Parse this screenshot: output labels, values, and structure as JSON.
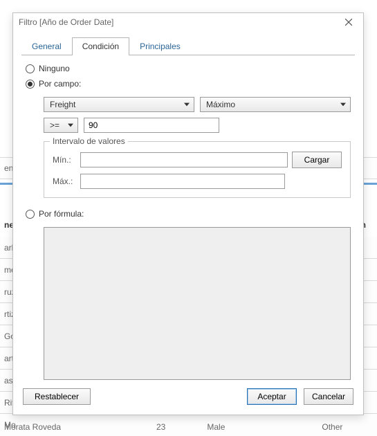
{
  "dialog": {
    "title": "Filtro [Año de Order Date]"
  },
  "tabs": {
    "general": "General",
    "condicion": "Condición",
    "principales": "Principales"
  },
  "radios": {
    "none": "Ninguno",
    "by_field": "Por campo:",
    "by_formula": "Por fórmula:"
  },
  "fields": {
    "field_name": "Freight",
    "aggregation": "Máximo",
    "operator": ">=",
    "value": "90"
  },
  "range_group": {
    "legend": "Intervalo de valores",
    "min_label": "Mín.:",
    "max_label": "Máx.:",
    "min_value": "",
    "max_value": "",
    "load_btn": "Cargar"
  },
  "footer": {
    "reset": "Restablecer",
    "ok": "Aceptar",
    "cancel": "Cancelar"
  },
  "background": {
    "hdr_left": "ne",
    "hdr_right": "en",
    "rows_left": [
      "arlos",
      "mez",
      "ruz",
      "rtiz",
      "Gon",
      "artí",
      "asti",
      "Riva",
      "Mo"
    ],
    "last_row_name": "Morata Roveda",
    "last_row_age": "23",
    "last_row_g": "Male",
    "last_row_eth": "Other",
    "en_c": "en c"
  }
}
